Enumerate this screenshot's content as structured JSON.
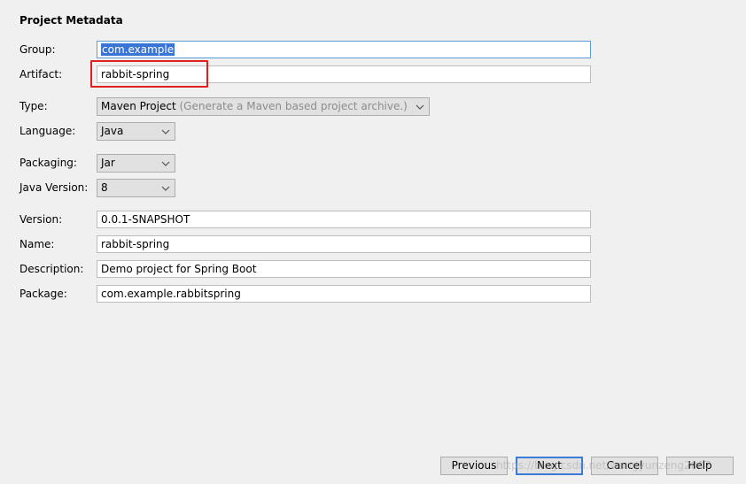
{
  "section_title": "Project Metadata",
  "labels": {
    "group": "Group:",
    "artifact": "Artifact:",
    "type": "Type:",
    "language": "Language:",
    "packaging": "Packaging:",
    "java_version": "Java Version:",
    "version": "Version:",
    "name": "Name:",
    "description": "Description:",
    "package": "Package:"
  },
  "values": {
    "group": "com.example",
    "artifact": "rabbit-spring",
    "type": "Maven Project",
    "type_hint": "(Generate a Maven based project archive.)",
    "language": "Java",
    "packaging": "Jar",
    "java_version": "8",
    "version": "0.0.1-SNAPSHOT",
    "name": "rabbit-spring",
    "description": "Demo project for Spring Boot",
    "package": "com.example.rabbitspring"
  },
  "buttons": {
    "previous": "Previous",
    "next": "Next",
    "cancel": "Cancel",
    "help": "Help"
  },
  "watermark": "https://blog.csdn.net/wangyunzeng2007",
  "colors": {
    "highlight_border": "#e02020",
    "selection_bg": "#3875d7",
    "focus_border": "#5b9bd5"
  }
}
